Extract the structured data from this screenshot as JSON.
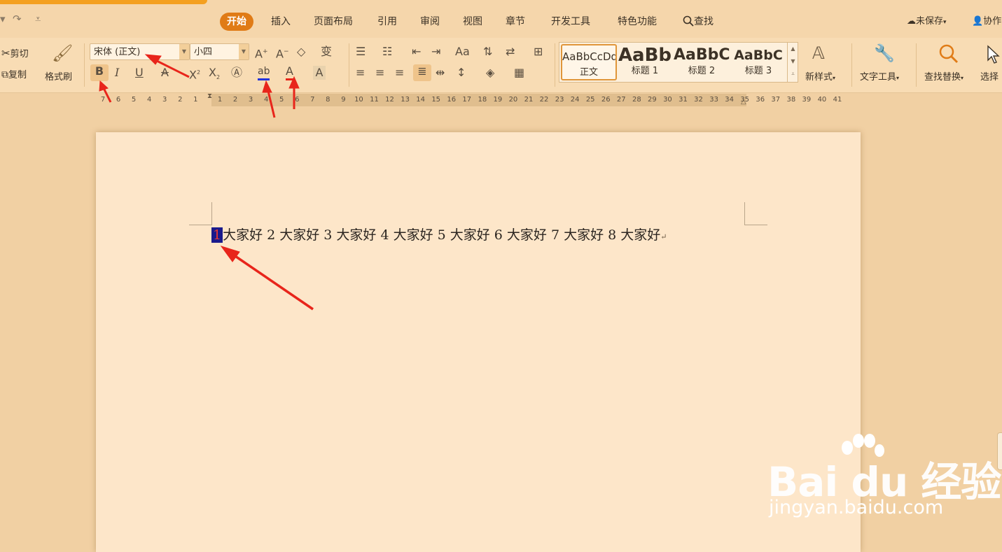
{
  "quick_access": {
    "dropdown": "▾",
    "redo": "↷",
    "more": "⩡"
  },
  "menu": {
    "tabs": [
      "开始",
      "插入",
      "页面布局",
      "引用",
      "审阅",
      "视图",
      "章节",
      "开发工具",
      "特色功能"
    ],
    "search": "查找",
    "unsaved": "未保存",
    "collab": "协作"
  },
  "clipboard": {
    "cut": "剪切",
    "copy": "复制",
    "format_painter": "格式刷"
  },
  "font": {
    "family": "宋体 (正文)",
    "size": "小四"
  },
  "styles": {
    "samples": [
      "AaBbCcDd",
      "AaBb",
      "AaBbC",
      "AaBbC"
    ],
    "names": [
      "正文",
      "标题 1",
      "标题 2",
      "标题 3"
    ],
    "new_style": "新样式"
  },
  "tools": {
    "text_tools": "文字工具",
    "find_replace": "查找替换",
    "select": "选择"
  },
  "ruler": {
    "left_ticks": [
      "7",
      "6",
      "5",
      "4",
      "3",
      "2",
      "1"
    ],
    "right_ticks": [
      "1",
      "2",
      "3",
      "4",
      "5",
      "6",
      "7",
      "8",
      "9",
      "10",
      "11",
      "12",
      "13",
      "14",
      "15",
      "16",
      "17",
      "18",
      "19",
      "20",
      "21",
      "22",
      "23",
      "24",
      "25",
      "26",
      "27",
      "28",
      "29",
      "30",
      "31",
      "32",
      "33",
      "34",
      "35",
      "36",
      "37",
      "38",
      "39",
      "40",
      "41"
    ]
  },
  "document": {
    "selected_char": "1",
    "text": "大家好 2 大家好 3 大家好 4 大家好 5 大家好 6 大家好 7 大家好 8 大家好",
    "paragraph_mark": "↵"
  },
  "watermark": {
    "text": "Bai du 经验",
    "url": "jingyan.baidu.com"
  },
  "colors": {
    "accent": "#e07b16",
    "selection": "#1a1a8c",
    "arrow": "#e8251b",
    "page": "#fde6c9"
  }
}
